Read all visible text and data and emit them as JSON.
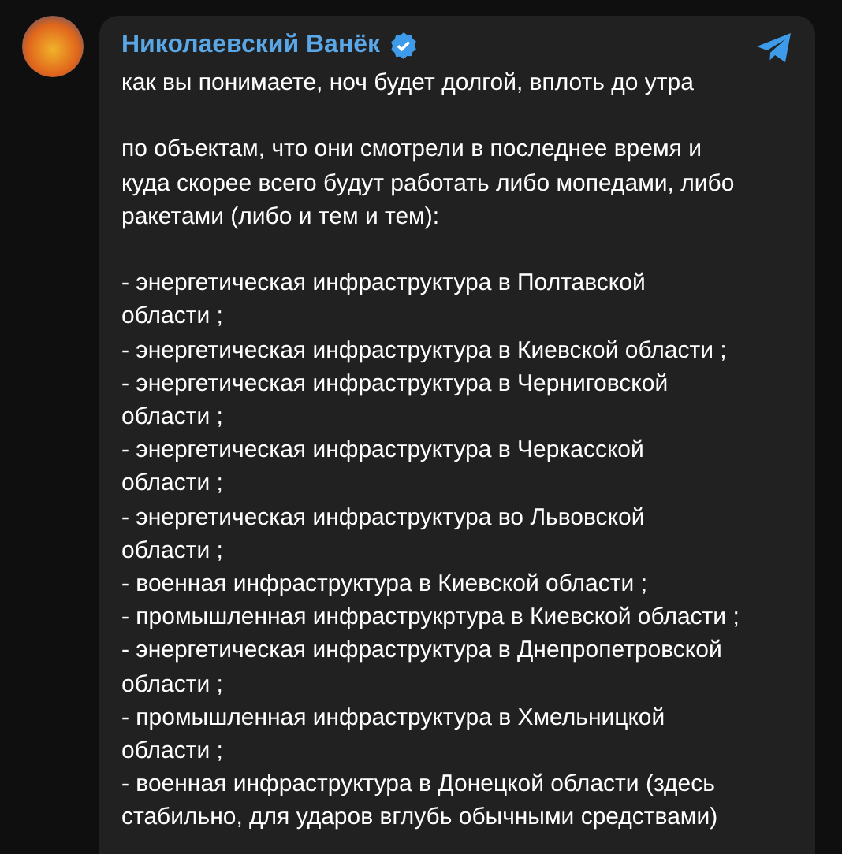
{
  "post": {
    "channel_name": "Николаевский Ванёк",
    "verified": true,
    "paragraphs": [
      "как вы понимаете, ноч будет долгой, вплоть до утра",
      "по объектам, что они смотрели в последнее время и\nкуда скорее всего будут работать либо мопедами, либо\nракетами (либо и тем и тем):"
    ],
    "list_items": [
      "- энергетическая инфраструктура в Полтавской\nобласти ;",
      "- энергетическая инфраструктура в Киевской области ;",
      "- энергетическая инфраструктура в Черниговской\nобласти ;",
      "- энергетическая инфраструктура в Черкасской\nобласти ;",
      "- энергетическая инфраструктура во Львовской\nобласти ;",
      "- военная инфраструктура в Киевской области ;",
      "- промышленная инфраструкртура в Киевской области ;",
      "- энергетическая инфраструктура в Днепропетровской\nобласти ;",
      "- промышленная инфраструктура в Хмельницкой\nобласти ;",
      "- военная инфраструктура в Донецкой области (здесь\nстабильно, для ударов вглубь обычными средствами)"
    ]
  }
}
